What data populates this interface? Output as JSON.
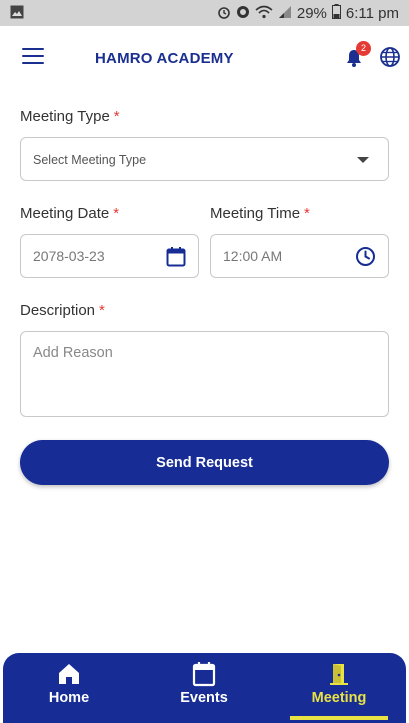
{
  "status_bar": {
    "battery": "29%",
    "time": "6:11 pm"
  },
  "app_bar": {
    "title": "HAMRO ACADEMY",
    "notification_count": "2"
  },
  "form": {
    "meeting_type": {
      "label": "Meeting Type",
      "required_mark": "*",
      "placeholder": "Select Meeting Type"
    },
    "meeting_date": {
      "label": "Meeting Date",
      "required_mark": "*",
      "value": "2078-03-23"
    },
    "meeting_time": {
      "label": "Meeting Time",
      "required_mark": "*",
      "value": "12:00 AM"
    },
    "description": {
      "label": "Description",
      "required_mark": "*",
      "placeholder": "Add Reason"
    },
    "submit_label": "Send Request"
  },
  "bottom_nav": {
    "items": [
      {
        "label": "Home",
        "icon": "home-icon"
      },
      {
        "label": "Events",
        "icon": "calendar-icon"
      },
      {
        "label": "Meeting",
        "icon": "door-icon",
        "active": true
      }
    ]
  },
  "colors": {
    "primary": "#172d95",
    "active_nav": "#e8e245",
    "required": "#e53935"
  }
}
